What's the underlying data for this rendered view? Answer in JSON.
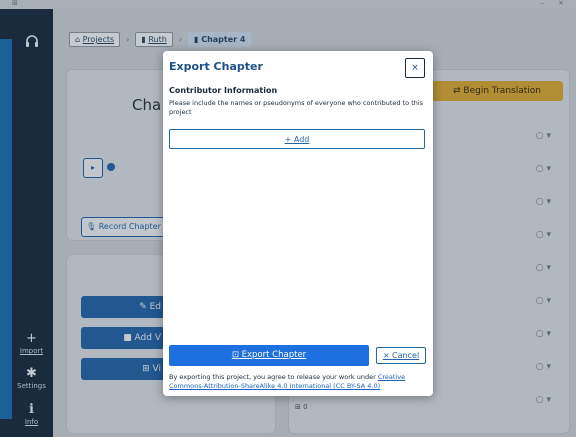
{
  "window": {
    "title_left": "⊞",
    "title_right": "– ×"
  },
  "sidebar": {
    "top_icon": "headphones-icon",
    "items": [
      {
        "label": "Import",
        "icon": "plus-icon",
        "glyph": "+"
      },
      {
        "label": "Settings",
        "icon": "gear-icon",
        "glyph": "✱"
      },
      {
        "label": "Info",
        "icon": "info-icon",
        "glyph": "ℹ"
      }
    ]
  },
  "breadcrumb": {
    "projects": "Projects",
    "book": "Ruth",
    "chapter": "Chapter 4",
    "sep": "›"
  },
  "background": {
    "chapter_heading": "Cha",
    "play": "▸",
    "record_label": "🎙 Record Chapter",
    "edit_label": "✎ Ed",
    "add_label": "■ Add V",
    "view_label": "⊞ Vi",
    "begin_translation": "⇄ Begin Translation",
    "bottom_row": "⊞ 0"
  },
  "modal": {
    "title": "Export Chapter",
    "close": "×",
    "section_title": "Contributor Information",
    "section_desc": "Please include the names or pseudonyms of everyone who contributed to this project",
    "add_label": "+ Add",
    "export_label": "⊡ Export Chapter",
    "cancel_label": "× Cancel",
    "footer_text": "By exporting this project, you agree to release your work under",
    "license_link": "Creative Commons-Attribution-ShareAlike 4.0 International (CC BY-SA 4.0)"
  },
  "colors": {
    "accent": "#1e6fe0",
    "brand": "#1d4f8a",
    "sidebar": "#1c2f44",
    "begin": "#d4a73a"
  }
}
